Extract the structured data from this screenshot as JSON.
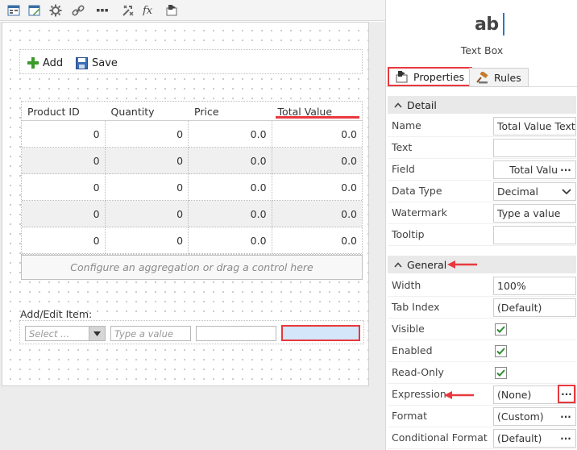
{
  "form": {
    "toolbar": {
      "add_label": "Add",
      "save_label": "Save"
    },
    "grid": {
      "columns": [
        "Product ID",
        "Quantity",
        "Price",
        "Total Value"
      ],
      "rows": [
        [
          "0",
          "0",
          "0.0",
          "0.0"
        ],
        [
          "0",
          "0",
          "0.0",
          "0.0"
        ],
        [
          "0",
          "0",
          "0.0",
          "0.0"
        ],
        [
          "0",
          "0",
          "0.0",
          "0.0"
        ],
        [
          "0",
          "0",
          "0.0",
          "0.0"
        ]
      ]
    },
    "aggregation_hint": "Configure an aggregation or drag a control here",
    "add_edit_label": "Add/Edit Item:",
    "select_placeholder": "Select ...",
    "textbox_placeholder": "Type a value"
  },
  "panel": {
    "control_glyph": "ab",
    "control_name": "Text Box",
    "tabs": {
      "properties": "Properties",
      "rules": "Rules"
    },
    "sections": {
      "detail": "Detail",
      "general": "General"
    },
    "detail": {
      "name_label": "Name",
      "name_value": "Total Value Text Box",
      "text_label": "Text",
      "text_value": "",
      "field_label": "Field",
      "field_value": "Total Valu",
      "datatype_label": "Data Type",
      "datatype_value": "Decimal",
      "watermark_label": "Watermark",
      "watermark_value": "Type a value",
      "tooltip_label": "Tooltip",
      "tooltip_value": ""
    },
    "general": {
      "width_label": "Width",
      "width_value": "100%",
      "tabindex_label": "Tab Index",
      "tabindex_value": "(Default)",
      "visible_label": "Visible",
      "enabled_label": "Enabled",
      "readonly_label": "Read-Only",
      "expression_label": "Expression",
      "expression_value": "(None)",
      "format_label": "Format",
      "format_value": "(Custom)",
      "condformat_label": "Conditional Format",
      "condformat_value": "(Default)"
    },
    "ellipsis": "···"
  },
  "colors": {
    "highlight": "#e8393f",
    "selected_fill": "#d4e6fa",
    "check": "#2e8b2e"
  }
}
